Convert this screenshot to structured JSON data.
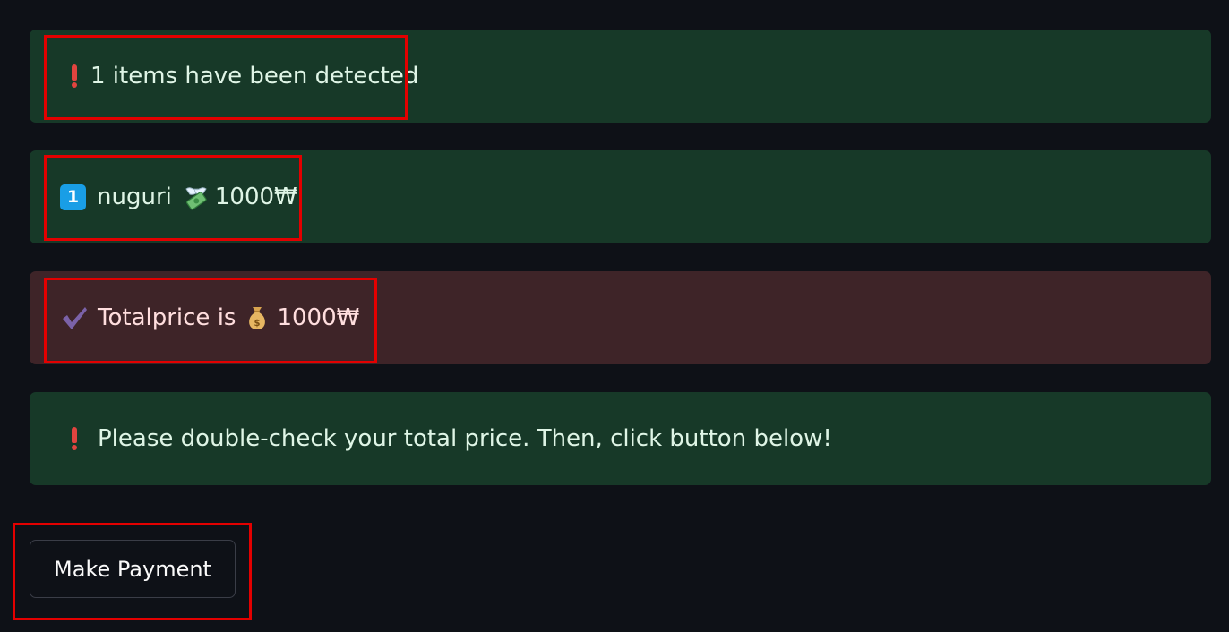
{
  "alerts": {
    "detected": {
      "icon": "exclamation-icon",
      "text": "1 items have been detected",
      "color": "#173928"
    },
    "item": {
      "badge": "1",
      "badge_icon": "keycap-one-icon",
      "name": "nuguri",
      "price_icon": "money-with-wings-icon",
      "price": "1000₩",
      "color": "#173928"
    },
    "total": {
      "icon": "check-mark-icon",
      "label": "Totalprice is",
      "price_icon": "money-bag-icon",
      "price": "1000₩",
      "color": "#3e2428"
    },
    "notice": {
      "icon": "exclamation-icon",
      "text": "Please double-check your total price. Then, click button below!",
      "color": "#173928"
    }
  },
  "payment_button": {
    "label": "Make Payment"
  },
  "highlight_color": "#e30000"
}
